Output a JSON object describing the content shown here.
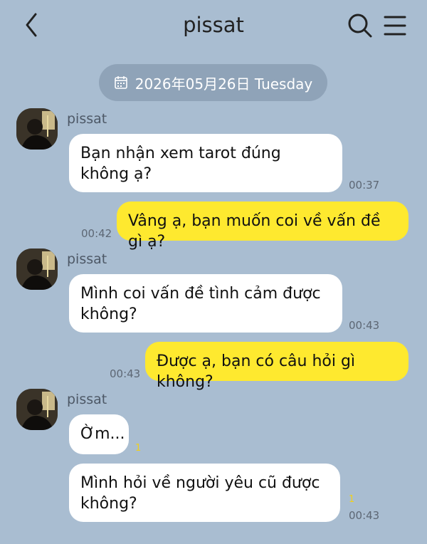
{
  "header": {
    "title": "pissat"
  },
  "date_divider": {
    "text": "2026年05月26日 Tuesday"
  },
  "messages": [
    {
      "from": "them",
      "sender": "pissat",
      "text": "Bạn nhận xem tarot đúng không ạ?",
      "time": "00:37"
    },
    {
      "from": "me",
      "text": "Vâng ạ, bạn muốn coi về vấn đề gì ạ?",
      "time": "00:42"
    },
    {
      "from": "them",
      "sender": "pissat",
      "text": "Mình coi vấn đề tình cảm được không?",
      "time": "00:43"
    },
    {
      "from": "me",
      "text": "Được ạ, bạn có câu hỏi gì không?",
      "time": "00:43"
    },
    {
      "from": "them",
      "sender": "pissat",
      "text": "Ờm...",
      "unread": "1"
    },
    {
      "from": "them",
      "text": "Mình hỏi về người yêu cũ được không?",
      "unread": "1",
      "time": "00:43"
    }
  ],
  "colors": {
    "background": "#a9bdd1",
    "my_bubble": "#fee92f",
    "their_bubble": "#ffffff",
    "date_pill": "#8fa3b8",
    "unread": "#f1d01a"
  },
  "icons": {
    "back": "chevron-left-icon",
    "search": "search-icon",
    "menu": "hamburger-menu-icon",
    "calendar": "calendar-icon"
  }
}
